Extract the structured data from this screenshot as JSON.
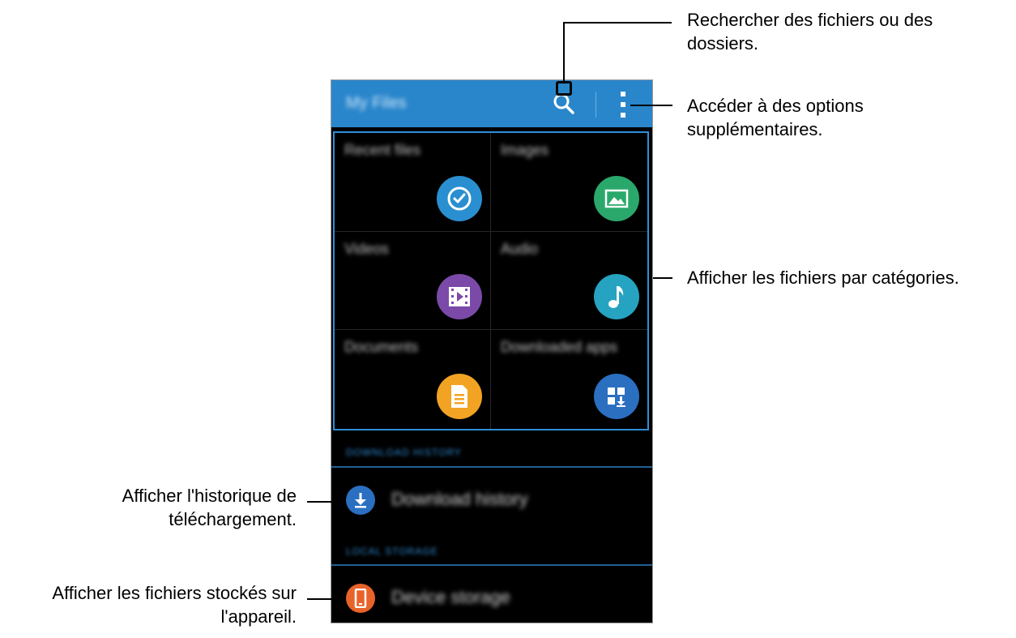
{
  "app": {
    "title": "My Files"
  },
  "action_bar": {
    "search_icon": "search-icon",
    "more_icon": "more-options-icon"
  },
  "categories": [
    {
      "label": "Recent files",
      "icon": "clock-icon",
      "color": "#2a8fd0"
    },
    {
      "label": "Images",
      "icon": "image-icon",
      "color": "#2aa86b"
    },
    {
      "label": "Videos",
      "icon": "video-icon",
      "color": "#7b4aa8"
    },
    {
      "label": "Audio",
      "icon": "music-note-icon",
      "color": "#26a3c0"
    },
    {
      "label": "Documents",
      "icon": "document-icon",
      "color": "#f2a323"
    },
    {
      "label": "Downloaded apps",
      "icon": "apps-download-icon",
      "color": "#2a6fc0"
    }
  ],
  "sections": {
    "download_history_header": "DOWNLOAD HISTORY",
    "download_history_label": "Download history",
    "local_storage_header": "LOCAL STORAGE",
    "device_storage_label": "Device storage"
  },
  "colors": {
    "action_bar": "#2a86cb",
    "highlight": "#2f8ed8",
    "download_icon": "#2a6fc0",
    "device_icon": "#e8632a"
  },
  "callouts": {
    "search": "Rechercher des fichiers ou des dossiers.",
    "more_options": "Accéder à des options supplémentaires.",
    "categories": "Afficher les fichiers par catégories.",
    "download_history": "Afficher l'historique de téléchargement.",
    "device_storage": "Afficher les fichiers stockés sur l'appareil."
  }
}
